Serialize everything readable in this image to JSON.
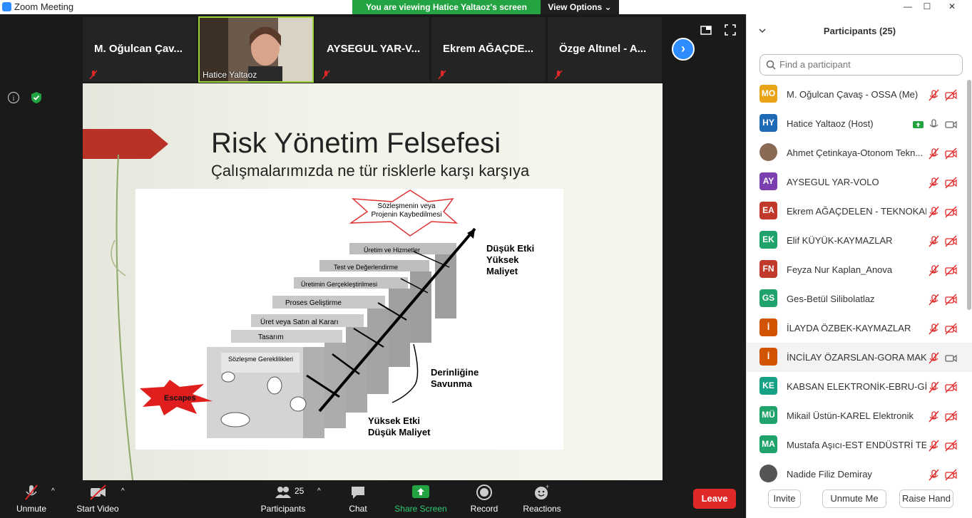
{
  "window": {
    "title": "Zoom Meeting",
    "blurred_title": "...",
    "min": "—",
    "max": "☐",
    "close": "✕"
  },
  "banner": {
    "viewing": "You are viewing Hatice Yaltaoz's screen",
    "view_options": "View Options"
  },
  "tiles": [
    {
      "name": "M. Oğulcan Çav..."
    },
    {
      "name": "AYSEGUL YAR-V..."
    },
    {
      "name": "Ekrem AĞAÇDE..."
    },
    {
      "name": "Özge Altınel - A..."
    }
  ],
  "video_tile": {
    "name": "Hatice Yaltaoz"
  },
  "slide": {
    "title": "Risk Yönetim Felsefesi",
    "subtitle": "Çalışmalarımızda ne tür risklerle karşı karşıya",
    "diagram": {
      "star_top": [
        "Sözleşmenin veya",
        "Projenin Kaybedilmesi"
      ],
      "layers": [
        "Üretim ve Hizmetler",
        "Test ve Değerlendirme",
        "Üretimin Gerçekleştirilmesi",
        "Proses Geliştirme",
        "Üret veya Satın al Kararı",
        "Tasarım",
        "Sözleşme Gereklilikleri"
      ],
      "right_top": [
        "Düşük Etki",
        "Yüksek",
        "Maliyet"
      ],
      "middle": [
        "Derinliğine",
        "Savunma"
      ],
      "bottom": [
        "Yüksek Etki",
        "Düşük Maliyet"
      ],
      "escapes": "Escapes"
    }
  },
  "toolbar": {
    "unmute": "Unmute",
    "start_video": "Start Video",
    "participants": "Participants",
    "participants_count": "25",
    "chat": "Chat",
    "share": "Share Screen",
    "record": "Record",
    "reactions": "Reactions",
    "leave": "Leave"
  },
  "panel": {
    "title": "Participants (25)",
    "search_placeholder": "Find a participant",
    "participants": [
      {
        "initials": "MO",
        "name": "M. Oğulcan Çavaş - OSSA (Me)",
        "color": "#e8a317"
      },
      {
        "initials": "HY",
        "name": "Hatice Yaltaoz (Host)",
        "color": "#1f6ab5"
      },
      {
        "initials": "",
        "name": "Ahmet Çetinkaya-Otonom Tekn...",
        "color": "#8a6a55"
      },
      {
        "initials": "AY",
        "name": "AYSEGUL YAR-VOLO",
        "color": "#7b3fb0"
      },
      {
        "initials": "EA",
        "name": "Ekrem AĞAÇDELEN - TEKNOKAR",
        "color": "#c0392b"
      },
      {
        "initials": "EK",
        "name": "Elif KÜYÜK-KAYMAZLAR",
        "color": "#1fa36b"
      },
      {
        "initials": "FN",
        "name": "Feyza Nur Kaplan_Anova",
        "color": "#c0392b"
      },
      {
        "initials": "GS",
        "name": "Ges-Betül Silibolatlaz",
        "color": "#1fa36b"
      },
      {
        "initials": "İ",
        "name": "İLAYDA ÖZBEK-KAYMAZLAR",
        "color": "#d35400"
      },
      {
        "initials": "İ",
        "name": "İNCİLAY ÖZARSLAN-GORA MAK...",
        "color": "#d35400"
      },
      {
        "initials": "KE",
        "name": "KABSAN ELEKTRONİK-EBRU-GİZ...",
        "color": "#16a085"
      },
      {
        "initials": "MÜ",
        "name": "Mikail Üstün-KAREL Elektronik",
        "color": "#1fa36b"
      },
      {
        "initials": "MA",
        "name": "Mustafa Aşıcı-EST ENDÜSTRİ TE...",
        "color": "#1fa36b"
      },
      {
        "initials": "",
        "name": "Nadide Filiz Demiray",
        "color": "#555555"
      }
    ],
    "invite": "Invite",
    "unmute_me": "Unmute Me",
    "raise_hand": "Raise Hand"
  }
}
